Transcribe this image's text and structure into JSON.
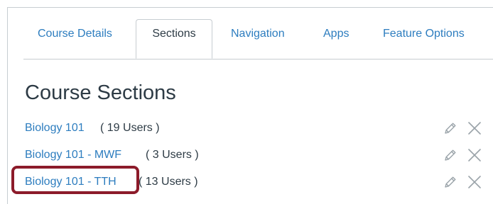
{
  "tabs": [
    {
      "label": "Course Details",
      "active": false
    },
    {
      "label": "Sections",
      "active": true
    },
    {
      "label": "Navigation",
      "active": false
    },
    {
      "label": "Apps",
      "active": false
    },
    {
      "label": "Feature Options",
      "active": false
    }
  ],
  "page": {
    "heading": "Course Sections"
  },
  "sections": [
    {
      "name": "Biology 101",
      "users": "( 19 Users )"
    },
    {
      "name": "Biology 101 - MWF",
      "users": "( 3 Users )"
    },
    {
      "name": "Biology 101 - TTH",
      "users": "( 13 Users )"
    }
  ],
  "colors": {
    "link": "#2d7dbf",
    "text": "#2d3b45",
    "border": "#c7cdd1",
    "highlight": "#8c1b2a",
    "icon": "#9aa3a9"
  },
  "icons": {
    "edit": "pencil-icon",
    "delete": "close-icon"
  }
}
